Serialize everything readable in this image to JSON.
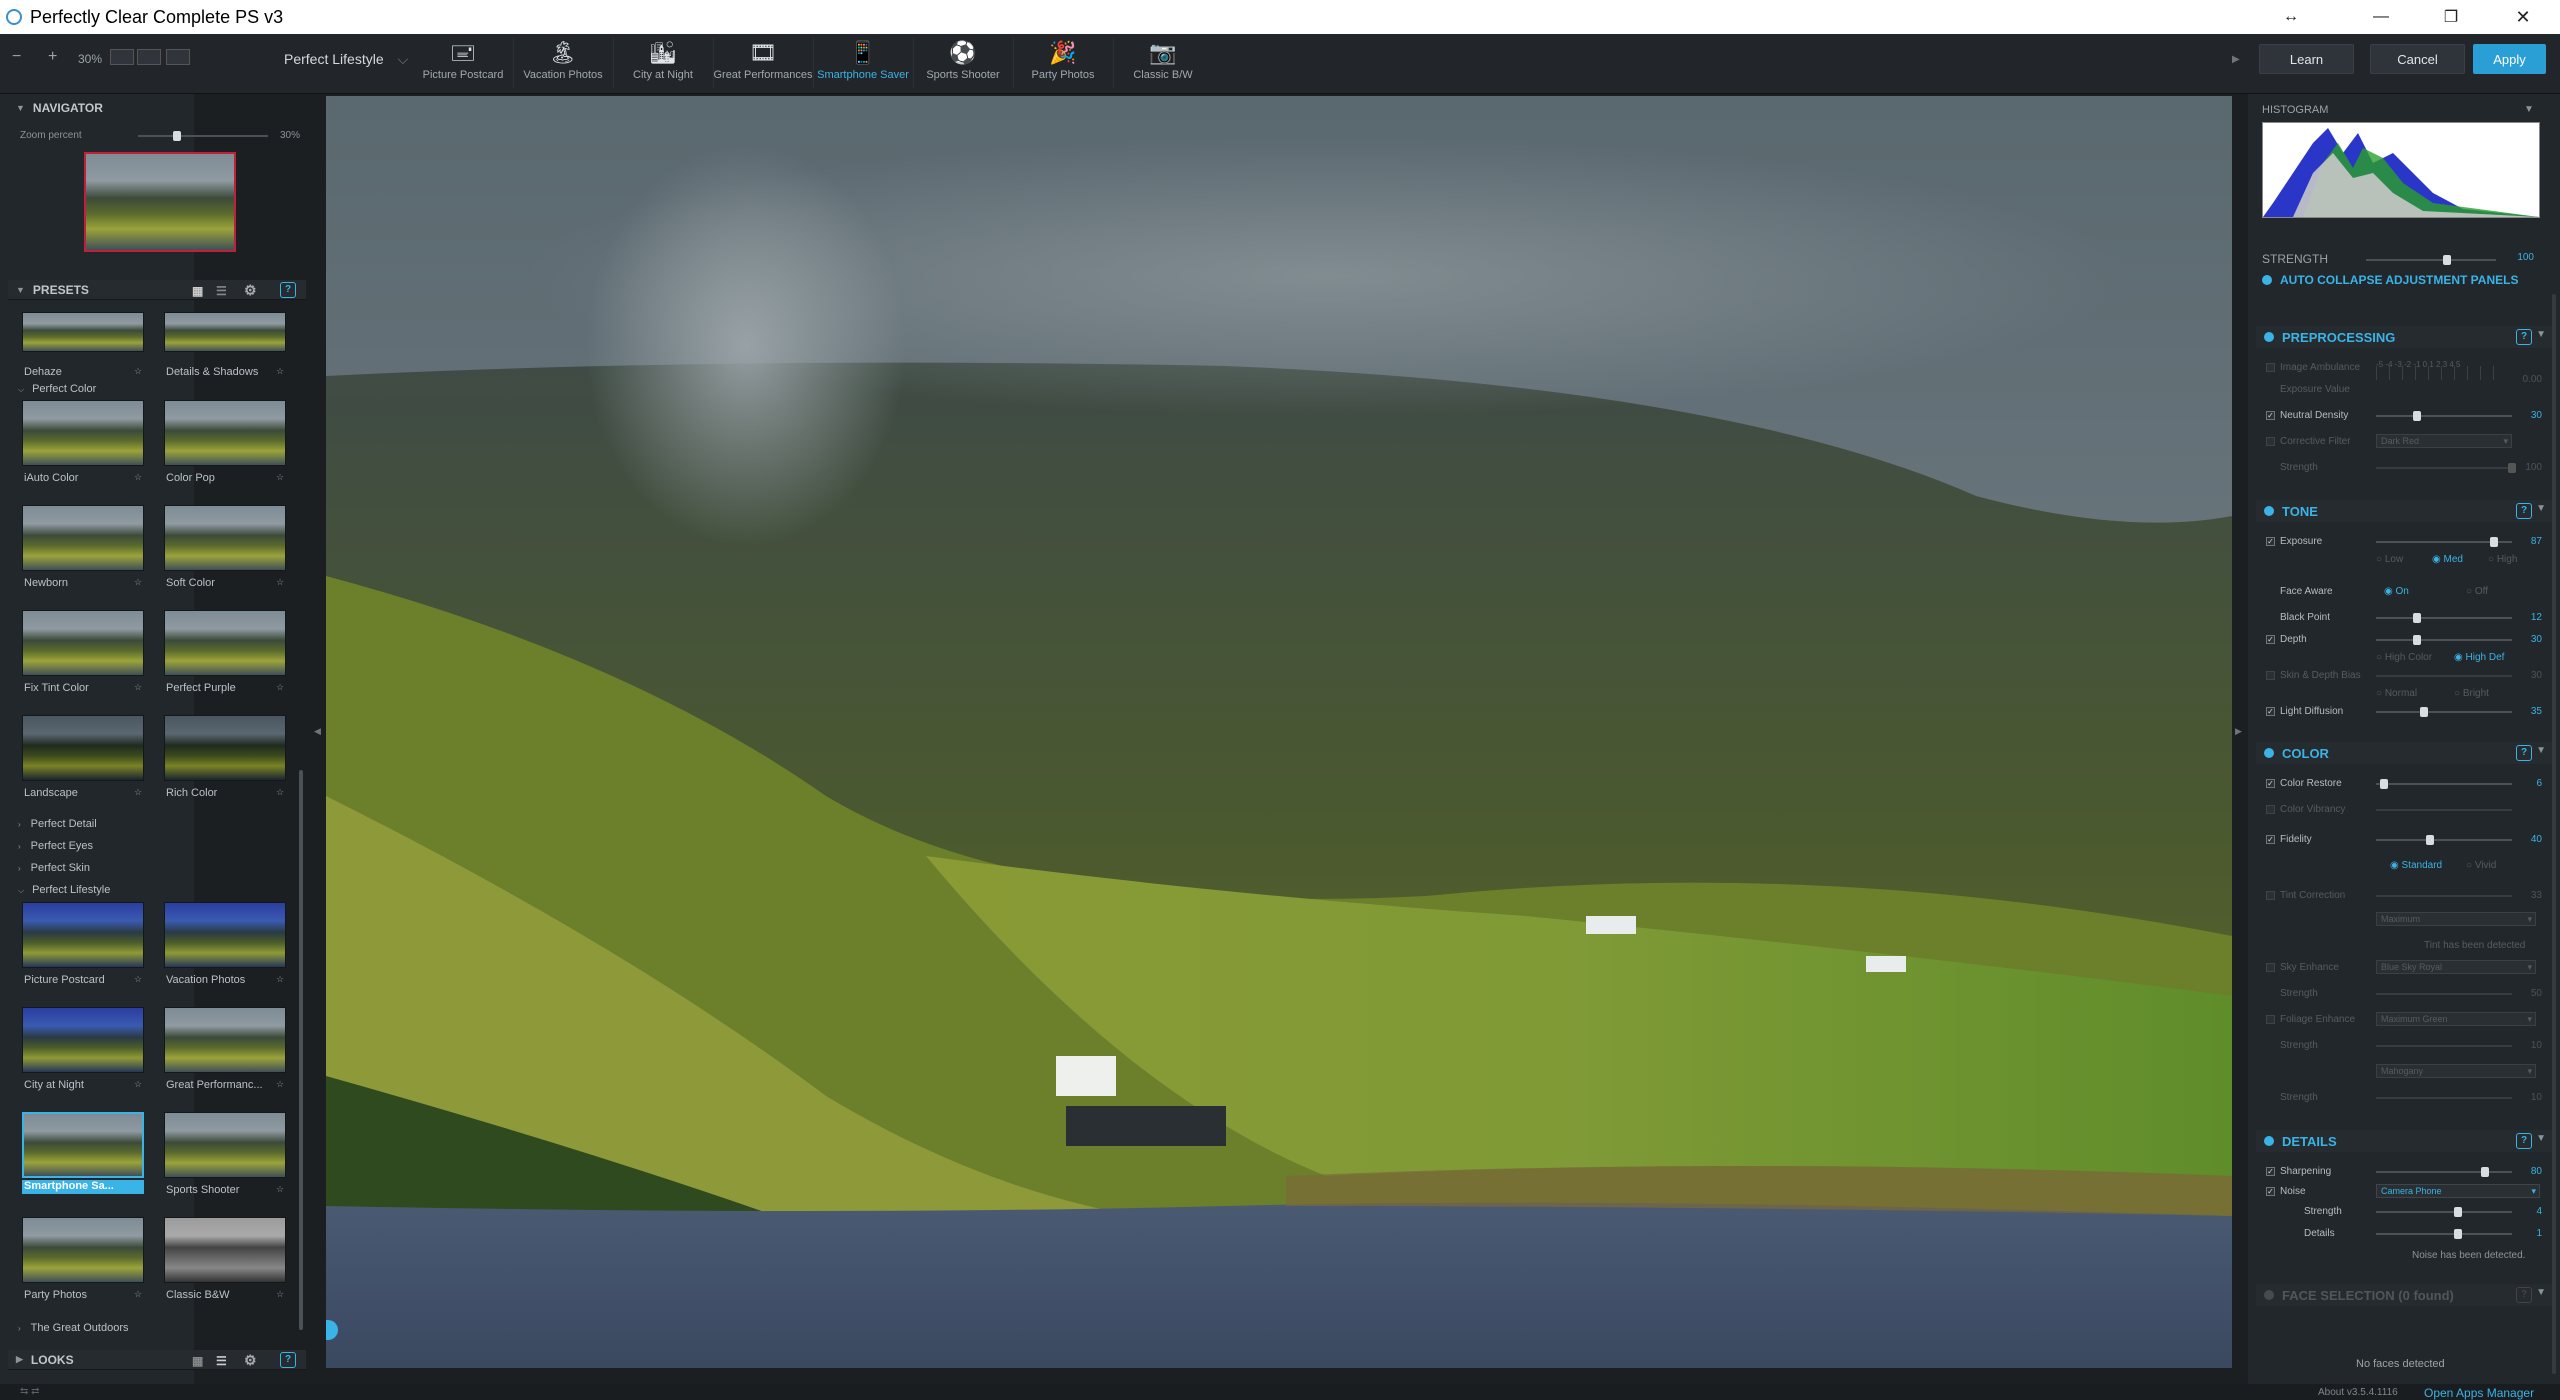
{
  "window": {
    "title": "Perfectly Clear Complete PS v3",
    "minimize": "—",
    "restore": "❐",
    "close": "✕",
    "move": "↔"
  },
  "toolbar": {
    "zoom_minus": "−",
    "zoom_plus": "+",
    "zoom_value": "30%",
    "preset_group": "Perfect Lifestyle",
    "preset_group_chevron": "⌵",
    "presets": [
      {
        "label": "Picture Postcard",
        "icon": "postcard-icon",
        "glyph": "🖃"
      },
      {
        "label": "Vacation Photos",
        "icon": "palm-tree-icon",
        "glyph": "🏝"
      },
      {
        "label": "City at Night",
        "icon": "city-icon",
        "glyph": "🏙"
      },
      {
        "label": "Great Performances",
        "icon": "film-icon",
        "glyph": "🎞"
      },
      {
        "label": "Smartphone Saver",
        "icon": "smartphone-icon",
        "glyph": "📱"
      },
      {
        "label": "Sports Shooter",
        "icon": "soccer-ball-icon",
        "glyph": "⚽"
      },
      {
        "label": "Party Photos",
        "icon": "party-icon",
        "glyph": "🎉"
      },
      {
        "label": "Classic B/W",
        "icon": "camera-icon",
        "glyph": "📷"
      }
    ],
    "learn": "Learn",
    "cancel": "Cancel",
    "apply": "Apply",
    "accent": "#3ab3e6"
  },
  "navigator": {
    "title": "NAVIGATOR",
    "zoom_label": "Zoom percent",
    "zoom_value": "30%",
    "zoom_fraction": 0.3
  },
  "presets_panel": {
    "title": "PRESETS",
    "items_top": [
      {
        "label": "Dehaze"
      },
      {
        "label": "Details & Shadows"
      }
    ],
    "group_color": "Perfect Color",
    "color_items": [
      {
        "label": "iAuto Color"
      },
      {
        "label": "Color Pop"
      },
      {
        "label": "Newborn"
      },
      {
        "label": "Soft Color"
      },
      {
        "label": "Fix Tint Color"
      },
      {
        "label": "Perfect Purple"
      },
      {
        "label": "Landscape"
      },
      {
        "label": "Rich Color"
      }
    ],
    "collapsed_groups": [
      "Perfect Detail",
      "Perfect Eyes",
      "Perfect Skin"
    ],
    "group_lifestyle": "Perfect Lifestyle",
    "lifestyle_items": [
      {
        "label": "Picture Postcard"
      },
      {
        "label": "Vacation Photos"
      },
      {
        "label": "City at Night"
      },
      {
        "label": "Great Performanc..."
      },
      {
        "label": "Smartphone Sa..."
      },
      {
        "label": "Sports Shooter"
      },
      {
        "label": "Party Photos"
      },
      {
        "label": "Classic B&W"
      }
    ],
    "group_outdoors": "The Great Outdoors",
    "looks_title": "LOOKS"
  },
  "right": {
    "histogram_title": "HISTOGRAM",
    "strength_label": "STRENGTH",
    "strength_value": "100",
    "strength": 100,
    "auto_collapse": "AUTO COLLAPSE ADJUSTMENT PANELS",
    "preprocessing": {
      "title": "PREPROCESSING",
      "image_ambulance": "Image Ambulance",
      "ambulance_scale": "-5 -4 -3 -2 -1 0 1 2 3 4 5",
      "ambulance_value": "0.00",
      "exposure_value": "Exposure Value",
      "neutral_density": "Neutral Density",
      "nd_value": "30",
      "nd": 30,
      "corrective_filter": "Corrective Filter",
      "cf_option": "Dark Red",
      "strength": "Strength",
      "strength_value": "100"
    },
    "tone": {
      "title": "TONE",
      "exposure": "Exposure",
      "exposure_value": "87",
      "exposure_v": 87,
      "low": "Low",
      "med": "Med",
      "high": "High",
      "face_aware": "Face Aware",
      "on": "On",
      "off": "Off",
      "black_point": "Black Point",
      "bp_value": "12",
      "bp": 12,
      "depth": "Depth",
      "depth_value": "30",
      "depth_v": 30,
      "high_color": "High Color",
      "high_def": "High Def",
      "skin_depth_bias": "Skin & Depth Bias",
      "sdb_value": "30",
      "normal": "Normal",
      "bright": "Bright",
      "light_diffusion": "Light Diffusion",
      "ld_value": "35",
      "ld": 35
    },
    "color": {
      "title": "COLOR",
      "color_restore": "Color Restore",
      "cr_value": "6",
      "cr": 6,
      "color_vibrancy": "Color Vibrancy",
      "fidelity": "Fidelity",
      "fid_value": "40",
      "fid": 40,
      "standard": "Standard",
      "vivid": "Vivid",
      "tint_correction": "Tint Correction",
      "tc_value": "33",
      "tc_option": "Maximum",
      "tint_msg": "Tint has been detected",
      "sky_enhance": "Sky Enhance",
      "sky_option": "Blue Sky Royal",
      "sky_strength": "Strength",
      "sky_value": "50",
      "foliage_enhance": "Foliage Enhance",
      "fol_option": "Maximum Green",
      "fol_strength": "Strength",
      "fol_value": "10",
      "fol_option2": "Mahogany",
      "strength3": "Strength",
      "s3_value": "10"
    },
    "details": {
      "title": "DETAILS",
      "sharpening": "Sharpening",
      "sharp_value": "80",
      "sharp": 80,
      "noise": "Noise",
      "noise_option": "Camera Phone",
      "strength": "Strength",
      "strength_value": "4",
      "details": "Details",
      "details_value": "1",
      "noise_msg": "Noise has been detected."
    },
    "face": {
      "title": "FACE SELECTION (0 found)",
      "none": "No faces detected"
    }
  },
  "status": {
    "version": "About v3.5.4.1116",
    "apps_manager": "Open Apps Manager"
  }
}
